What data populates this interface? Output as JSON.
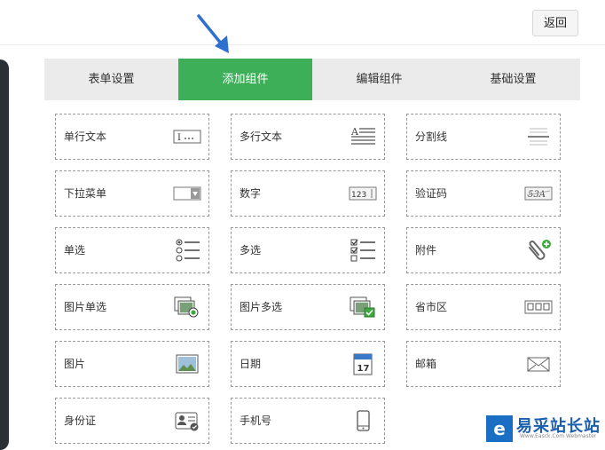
{
  "header": {
    "back_label": "返回"
  },
  "tabs": [
    {
      "label": "表单设置",
      "active": false
    },
    {
      "label": "添加组件",
      "active": true
    },
    {
      "label": "编辑组件",
      "active": false
    },
    {
      "label": "基础设置",
      "active": false
    }
  ],
  "components": {
    "single_line_text": {
      "label": "单行文本",
      "icon": "text-input-icon"
    },
    "multi_line_text": {
      "label": "多行文本",
      "icon": "paragraph-icon"
    },
    "divider": {
      "label": "分割线",
      "icon": "divider-lines-icon"
    },
    "dropdown": {
      "label": "下拉菜单",
      "icon": "select-dropdown-icon"
    },
    "number": {
      "label": "数字",
      "icon": "number-input-icon",
      "icon_text": "123"
    },
    "captcha": {
      "label": "验证码",
      "icon": "captcha-icon",
      "icon_text": "53A"
    },
    "radio": {
      "label": "单选",
      "icon": "radio-list-icon"
    },
    "checkbox": {
      "label": "多选",
      "icon": "checkbox-list-icon"
    },
    "attachment": {
      "label": "附件",
      "icon": "paperclip-add-icon"
    },
    "image_radio": {
      "label": "图片单选",
      "icon": "image-radio-icon"
    },
    "image_checkbox": {
      "label": "图片多选",
      "icon": "image-checkbox-icon"
    },
    "region": {
      "label": "省市区",
      "icon": "region-boxes-icon"
    },
    "image": {
      "label": "图片",
      "icon": "image-icon"
    },
    "date": {
      "label": "日期",
      "icon": "calendar-icon",
      "icon_text": "17"
    },
    "email": {
      "label": "邮箱",
      "icon": "envelope-icon"
    },
    "id_card": {
      "label": "身份证",
      "icon": "id-card-icon"
    },
    "phone": {
      "label": "手机号",
      "icon": "mobile-phone-icon"
    }
  },
  "watermark": {
    "logo_letter": "e",
    "title": "易采站长站",
    "subtitle": "Www.Easck.Com Webmaster"
  },
  "colors": {
    "accent_green": "#3daf59",
    "tab_bar_bg": "#ebebeb",
    "arrow_blue": "#2f6fd0"
  }
}
